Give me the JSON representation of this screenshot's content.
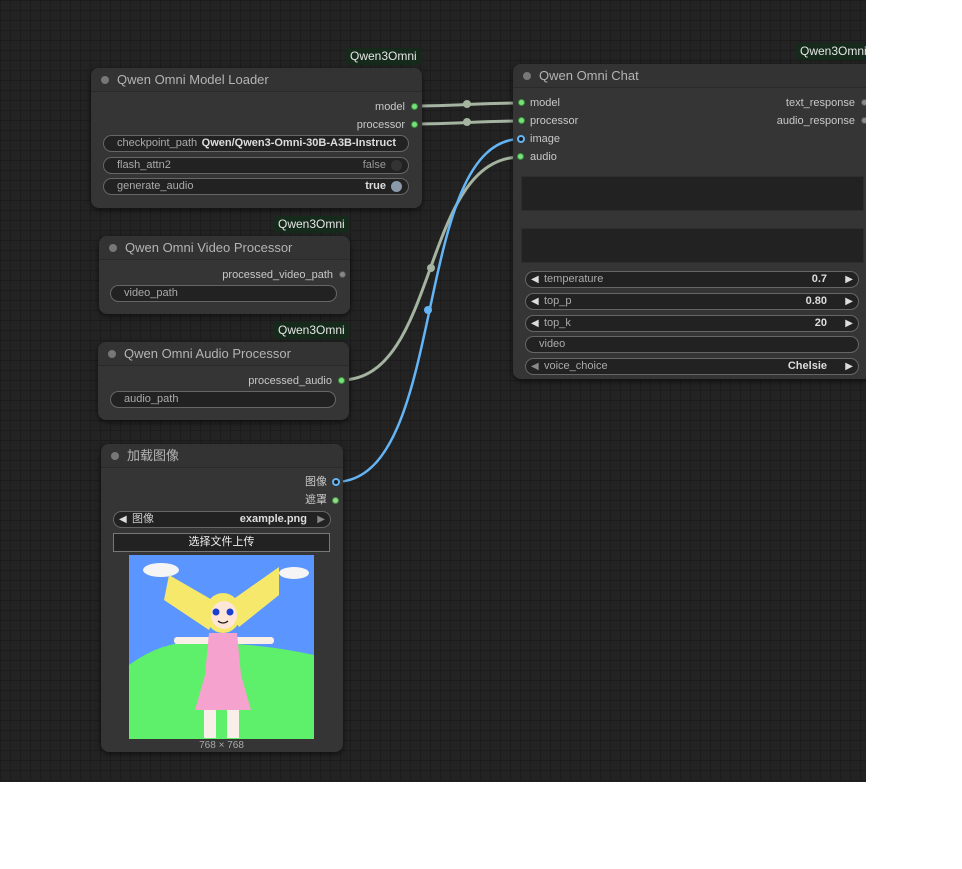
{
  "colors": {
    "canvas_bg": "#232323",
    "link_model": "#a4b4a0",
    "link_image": "#64b5f6",
    "slot_green": "#78e07a",
    "slot_blue": "#64b5f6",
    "badge_bg": "#152a1b"
  },
  "nodes": {
    "model_loader": {
      "badge": "Qwen3Omni",
      "title": "Qwen Omni Model Loader",
      "outputs": [
        "model",
        "processor"
      ],
      "widgets": {
        "checkpoint_path": {
          "label": "checkpoint_path",
          "value": "Qwen/Qwen3-Omni-30B-A3B-Instruct"
        },
        "flash_attn2": {
          "label": "flash_attn2",
          "value": "false"
        },
        "generate_audio": {
          "label": "generate_audio",
          "value": "true"
        }
      }
    },
    "video_processor": {
      "badge": "Qwen3Omni",
      "title": "Qwen Omni Video Processor",
      "outputs": [
        "processed_video_path"
      ],
      "widgets": {
        "video_path": {
          "label": "video_path"
        }
      }
    },
    "audio_processor": {
      "badge": "Qwen3Omni",
      "title": "Qwen Omni Audio Processor",
      "outputs": [
        "processed_audio"
      ],
      "widgets": {
        "audio_path": {
          "label": "audio_path"
        }
      }
    },
    "load_image": {
      "title": "加载图像",
      "outputs": [
        "图像",
        "遮罩"
      ],
      "widgets": {
        "image": {
          "label": "图像",
          "value": "example.png"
        },
        "upload": {
          "label": "选择文件上传"
        }
      },
      "preview": {
        "size": "768 × 768",
        "icon": "cartoon-girl-drawing"
      }
    },
    "chat": {
      "badge": "Qwen3Omni",
      "title": "Qwen Omni Chat",
      "inputs": [
        "model",
        "processor",
        "image",
        "audio"
      ],
      "outputs": [
        "text_response",
        "audio_response"
      ],
      "widgets": {
        "temperature": {
          "label": "temperature",
          "value": "0.7"
        },
        "top_p": {
          "label": "top_p",
          "value": "0.80"
        },
        "top_k": {
          "label": "top_k",
          "value": "20"
        },
        "video": {
          "label": "video"
        },
        "voice_choice": {
          "label": "voice_choice",
          "value": "Chelsie"
        }
      }
    }
  }
}
